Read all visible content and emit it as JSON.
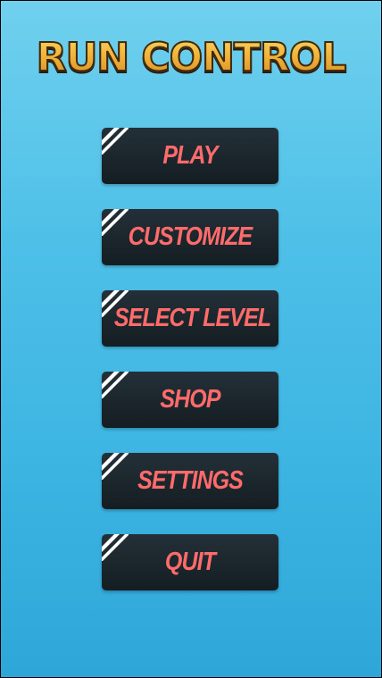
{
  "title": "RUN CONTROL",
  "menu": {
    "items": [
      {
        "label": "PLAY",
        "icon": "corner-stripes-icon"
      },
      {
        "label": "CUSTOMIZE",
        "icon": "corner-stripes-icon"
      },
      {
        "label": "SELECT LEVEL",
        "icon": "corner-stripes-icon"
      },
      {
        "label": "SHOP",
        "icon": "corner-stripes-icon"
      },
      {
        "label": "SETTINGS",
        "icon": "corner-stripes-icon"
      },
      {
        "label": "QUIT",
        "icon": "corner-stripes-icon"
      }
    ]
  },
  "colors": {
    "background_top": "#70d0ee",
    "background_bottom": "#2ea6d8",
    "button_bg": "#1b262c",
    "button_text": "#ff6b6b",
    "title_fill": "#f2b43a",
    "title_outline": "#3a2a14"
  }
}
